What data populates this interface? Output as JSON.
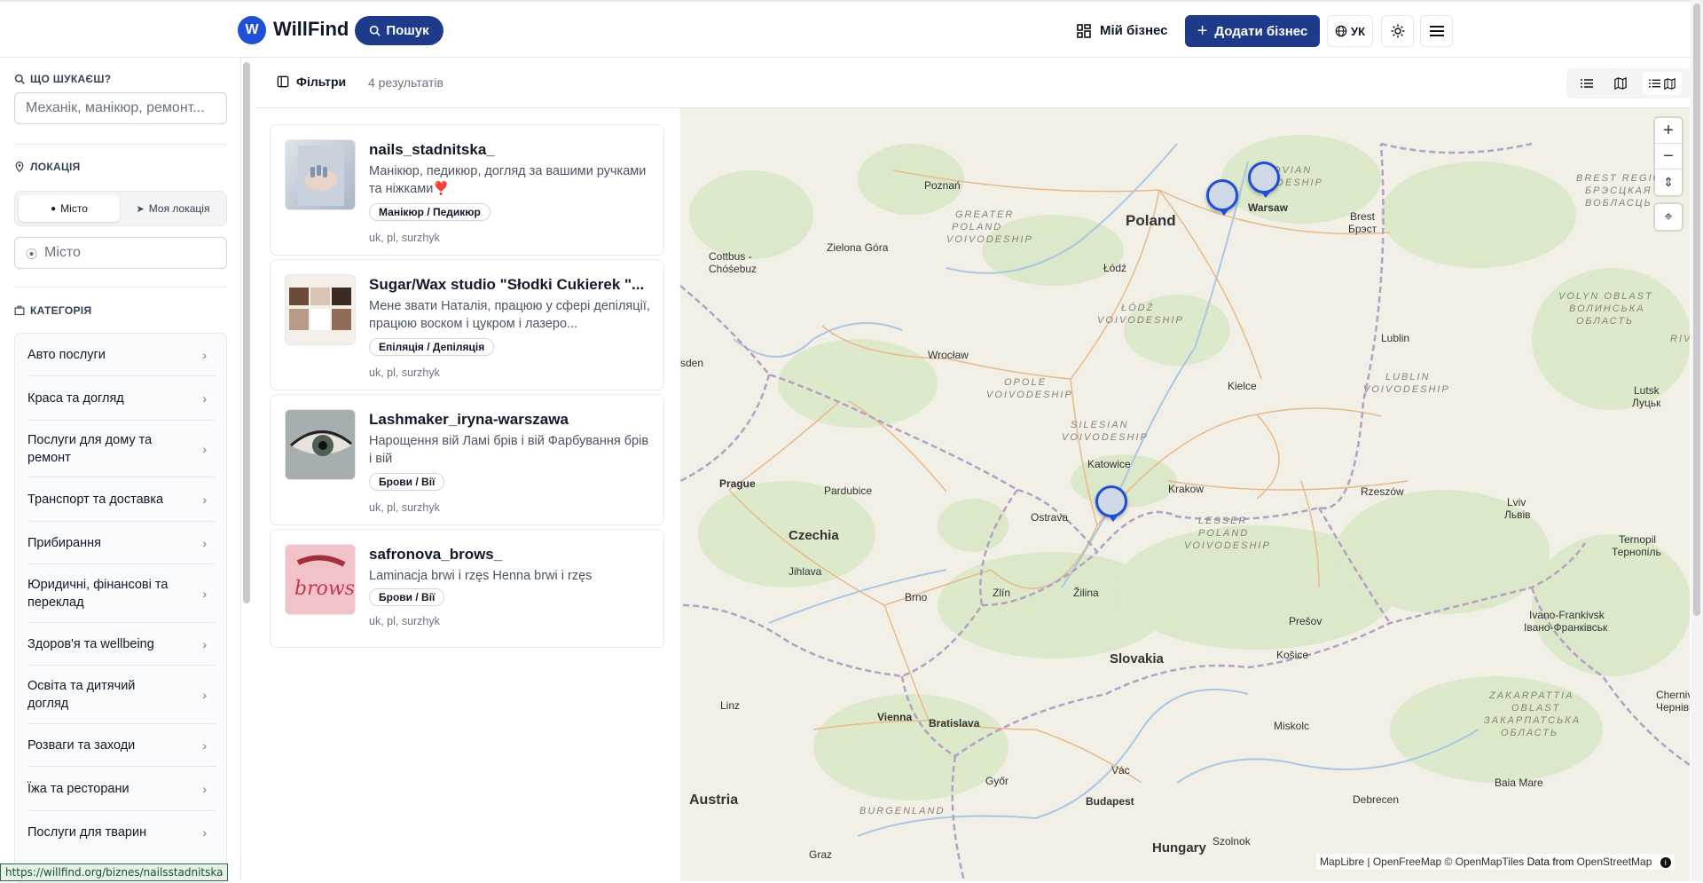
{
  "header": {
    "logo_letter": "W",
    "logo_text": "WillFind",
    "search_label": "Пошук",
    "my_business_label": "Мій бізнес",
    "add_business_label": "Додати бізнес",
    "language_label": "УК"
  },
  "sidebar": {
    "what_heading": "ЩО ШУКАЄШ?",
    "what_placeholder": "Механік, манікюр, ремонт...",
    "location_heading": "ЛОКАЦІЯ",
    "location_options": [
      "Місто",
      "Моя локація"
    ],
    "city_placeholder": "Місто",
    "category_heading": "КАТЕГОРІЯ",
    "categories": [
      "Авто послуги",
      "Краса та догляд",
      "Послуги для дому та ремонт",
      "Транспорт та доставка",
      "Прибирання",
      "Юридичні, фінансові та переклад",
      "Здоров'я та wellbeing",
      "Освіта та дитячий догляд",
      "Розваги та заходи",
      "Їжа та ресторани",
      "Послуги для тварин"
    ]
  },
  "toolbar": {
    "filters_label": "Фільтри",
    "results_count": "4 результатів"
  },
  "results": [
    {
      "title": "nails_stadnitska_",
      "description": "Манікюр, педикюр, догляд за вашими ручками та ніжками❣️",
      "tag": "Манікюр / Педикюр",
      "languages": "uk, pl, surzhyk"
    },
    {
      "title": "Sugar/Wax studio \"Słodki Cukierek \"...",
      "description": "Мене звати Наталія, працюю у сфері депіляції, працюю воском і цукром і лазеро...",
      "tag": "Епіляція / Депіляція",
      "languages": "uk, pl, surzhyk"
    },
    {
      "title": "Lashmaker_iryna-warszawa",
      "description": "Нарощення вій Ламі брів і вій Фарбування брів і вій",
      "tag": "Брови / Вії",
      "languages": "uk, pl, surzhyk"
    },
    {
      "title": "safronova_brows_",
      "description": "Laminacja brwi i rzęs Henna brwi i rzęs",
      "tag": "Брови / Вії",
      "languages": "uk, pl, surzhyk"
    }
  ],
  "map": {
    "labels": {
      "poland": "Poland",
      "czechia": "Czechia",
      "slovakia": "Slovakia",
      "austria": "Austria",
      "hungary": "Hungary",
      "warsaw": "Warsaw",
      "poznan": "Poznań",
      "zielona": "Zielona Góra",
      "lodz": "Łódź",
      "wroclaw": "Wrocław",
      "kielce": "Kielce",
      "lublin": "Lublin",
      "katowice": "Katowice",
      "krakow": "Krakow",
      "rzeszow": "Rzeszów",
      "prague": "Prague",
      "pardubice": "Pardubice",
      "ostrava": "Ostrava",
      "jihlava": "Jihlava",
      "brno": "Brno",
      "zlin": "Zlín",
      "zilina": "Žilina",
      "presov": "Prešov",
      "kosice": "Košice",
      "vienna": "Vienna",
      "bratislava": "Bratislava",
      "linz": "Linz",
      "gyor": "Győr",
      "vac": "Vác",
      "budapest": "Budapest",
      "miskolc": "Miskolc",
      "debrecen": "Debrecen",
      "szolnok": "Szolnok",
      "graz": "Graz",
      "brest": "Brest",
      "brest_cyr": "Брэст",
      "lviv": "Lviv",
      "lviv_cyr": "Львів",
      "ternopil": "Ternopil",
      "ternopil_cyr": "Тернопіль",
      "ivano": "Ivano-Frankivsk",
      "ivano_cyr": "Івано-Франківськ",
      "lutsk": "Lutsk",
      "lutsk_cyr": "Луцьк",
      "baia": "Baia Mare",
      "cottbus": "Cottbus -",
      "chosebuz": "Chóśebuz",
      "dresden": "sden",
      "cherniv": "Chernivt",
      "cherniv_cyr": "Чернівц",
      "gp1": "GREATER",
      "gp2": "POLAND",
      "gp3": "VOIVODESHIP",
      "ld1": "ŁÓDŹ",
      "ld2": "VOIVODESHIP",
      "op1": "OPOLE",
      "op2": "VOIVODESHIP",
      "si1": "SILESIAN",
      "si2": "VOIVODESHIP",
      "lp1": "LESSER",
      "lp2": "POLAND",
      "lp3": "VOIVODESHIP",
      "lu1": "LUBLIN",
      "lu2": "VOIVODESHIP",
      "ma1": "OVIAN",
      "ma2": "DESHIP",
      "vo1": "VOLYN OBLAST",
      "vo2": "ВОЛИНСЬКА",
      "vo3": "ОБЛАСТЬ",
      "br1": "BREST REGION",
      "br2": "БРЭСЦКАЯ",
      "br3": "ВОБЛАСЦЬ",
      "za1": "ZAKARPATTIA",
      "za2": "OBLAST",
      "za3": "ЗАКАРПАТСЬКА",
      "za4": "ОБЛАСТЬ",
      "bu1": "BURGENLAND",
      "riv": "RIV"
    },
    "zoom_in": "+",
    "zoom_out": "−",
    "attribution": "MapLibre | OpenFreeMap © OpenMapTiles",
    "attribution_data": "Data from",
    "attribution_osm": "OpenStreetMap"
  },
  "status_url": "https://willfind.org/biznes/nailsstadnitska",
  "colors": {
    "brand": "#1e3a8a",
    "accent": "#1e4fd6",
    "map_bg": "#f2efe6"
  }
}
